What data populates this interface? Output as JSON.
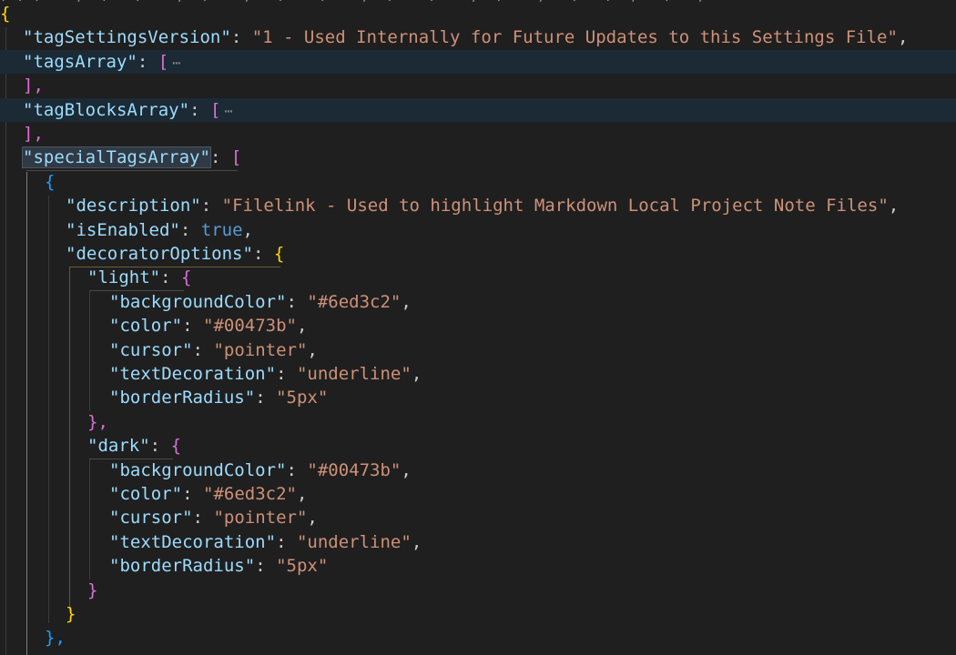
{
  "file": {
    "lines": [
      {
        "open": "{"
      },
      {
        "key": "tagSettingsVersion",
        "value": "1 - Used Internally for Future Updates to this Settings File"
      },
      {
        "key": "tagsArray",
        "open": "[",
        "fold": "⋯",
        "close": "],"
      },
      {
        "key": "tagBlocksArray",
        "open": "[",
        "fold": "⋯",
        "close": "],"
      },
      {
        "key": "specialTagsArray",
        "open": "["
      },
      {
        "open": "{"
      },
      {
        "key": "description",
        "value": "Filelink - Used to highlight Markdown Local Project Note Files"
      },
      {
        "key": "isEnabled",
        "value": "true"
      },
      {
        "key": "decoratorOptions",
        "open": "{"
      },
      {
        "key": "light",
        "open": "{"
      },
      {
        "key": "backgroundColor",
        "value": "#6ed3c2"
      },
      {
        "key": "color",
        "value": "#00473b"
      },
      {
        "key": "cursor",
        "value": "pointer"
      },
      {
        "key": "textDecoration",
        "value": "underline"
      },
      {
        "key": "borderRadius",
        "value": "5px"
      },
      {
        "close": "},"
      },
      {
        "key": "dark",
        "open": "{"
      },
      {
        "key": "backgroundColor",
        "value": "#00473b"
      },
      {
        "key": "color",
        "value": "#6ed3c2"
      },
      {
        "key": "cursor",
        "value": "pointer"
      },
      {
        "key": "textDecoration",
        "value": "underline"
      },
      {
        "key": "borderRadius",
        "value": "5px"
      },
      {
        "close": "}"
      },
      {
        "close": "}"
      },
      {
        "close": "},"
      }
    ]
  },
  "theme": {
    "background": "#1f1f1f",
    "key_color": "#9cdcfe",
    "string_color": "#ce9178",
    "keyword_color": "#569cd6",
    "bracket_colors": [
      "#ffd700",
      "#da70d6",
      "#179fff"
    ],
    "highlight_line": "#1b2a35"
  }
}
